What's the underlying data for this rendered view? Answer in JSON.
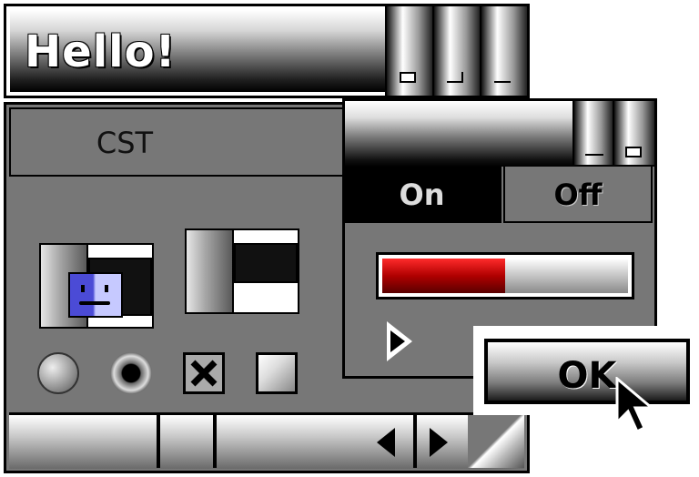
{
  "hello_window": {
    "title": "Hello!",
    "buttons": [
      {
        "name": "zoom-button",
        "icon": "zoom-icon"
      },
      {
        "name": "collapse-button",
        "icon": "collapse-icon"
      },
      {
        "name": "minimize-button",
        "icon": "minimize-icon"
      }
    ]
  },
  "cst_panel": {
    "header_label": "CST",
    "radio_states": [
      "unselected",
      "selected"
    ],
    "checkbox_states": [
      "checked",
      "unchecked"
    ],
    "icons": [
      "finder-icon",
      "folder-icon"
    ]
  },
  "onoff_window": {
    "tabs": [
      {
        "label": "On",
        "active": true
      },
      {
        "label": "Off",
        "active": false
      }
    ],
    "progress": 0.5,
    "progress_color": "#c00000"
  },
  "ok_button": {
    "label": "OK"
  },
  "colors": {
    "panel_gray": "#777777",
    "accent_red": "#c00000"
  }
}
